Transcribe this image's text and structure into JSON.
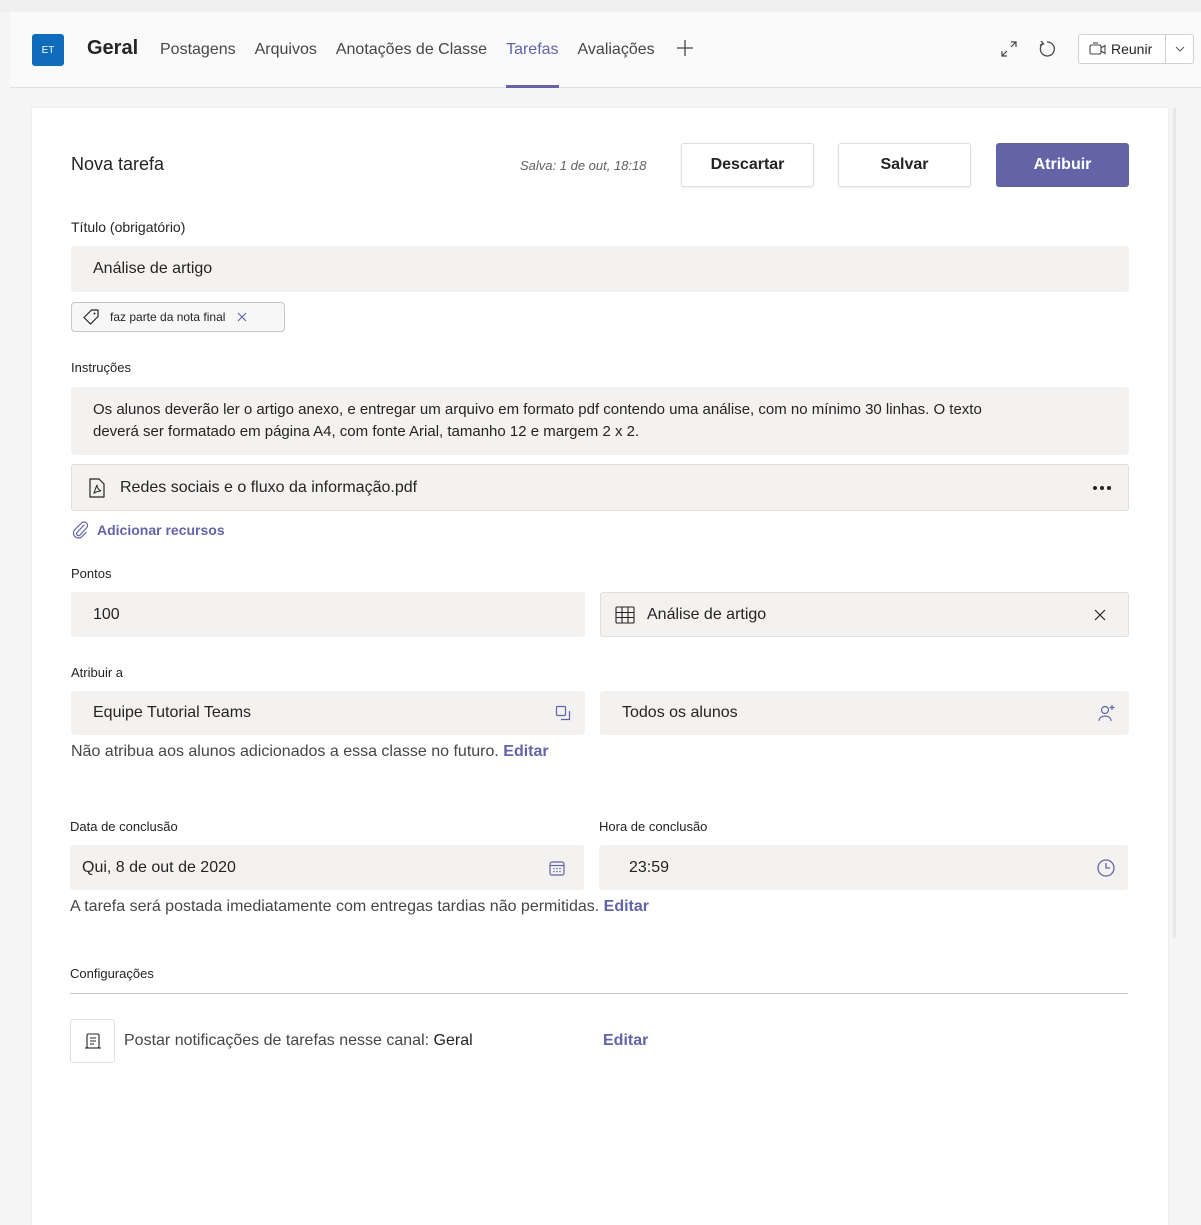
{
  "header": {
    "avatar_initials": "ET",
    "channel_title": "Geral",
    "tabs": [
      {
        "label": "Postagens"
      },
      {
        "label": "Arquivos"
      },
      {
        "label": "Anotações de Classe"
      },
      {
        "label": "Tarefas"
      },
      {
        "label": "Avaliações"
      }
    ],
    "active_tab": "Tarefas",
    "meet_label": "Reunir"
  },
  "form": {
    "heading": "Nova tarefa",
    "saved_status": "Salva: 1 de out, 18:18",
    "discard_label": "Descartar",
    "save_label": "Salvar",
    "assign_label": "Atribuir",
    "title_label": "Título (obrigatório)",
    "title_value": "Análise de artigo",
    "tag_label": "faz parte da nota final",
    "instructions_label": "Instruções",
    "instructions_line1": "Os alunos deverão ler o artigo anexo, e entregar um arquivo em formato pdf contendo uma análise, com no mínimo 30 linhas. O texto",
    "instructions_line2": "deverá ser formatado em página A4, com fonte Arial, tamanho 12 e margem 2 x 2.",
    "attachment_name": "Redes sociais e o fluxo da informação.pdf",
    "add_resources_label": "Adicionar recursos",
    "points_label": "Pontos",
    "points_value": "100",
    "rubric_name": "Análise de artigo",
    "assign_to_label": "Atribuir a",
    "class_value": "Equipe Tutorial Teams",
    "students_value": "Todos os alunos",
    "future_note": "Não atribua aos alunos adicionados a essa classe no futuro.",
    "future_edit_label": "Editar",
    "due_date_label": "Data de conclusão",
    "due_date_value": "Qui, 8 de out de 2020",
    "due_time_label": "Hora de conclusão",
    "due_time_value": "23:59",
    "post_note": "A tarefa será postada imediatamente com entregas tardias não permitidas.",
    "post_edit_label": "Editar",
    "settings_label": "Configurações",
    "notify_text": "Postar notificações de tarefas nesse canal:",
    "notify_channel": "Geral",
    "notify_edit_label": "Editar"
  },
  "colors": {
    "accent": "#6264a7",
    "avatar": "#0f6cbd",
    "field_bg": "#f3f2f1"
  },
  "icons": [
    "expand-icon",
    "refresh-icon",
    "video-icon",
    "chevron-down-icon",
    "tag-icon",
    "close-icon",
    "pdf-file-icon",
    "more-icon",
    "paperclip-icon",
    "rubric-grid-icon",
    "teams-select-icon",
    "add-student-icon",
    "calendar-icon",
    "clock-icon",
    "channel-notify-icon"
  ]
}
